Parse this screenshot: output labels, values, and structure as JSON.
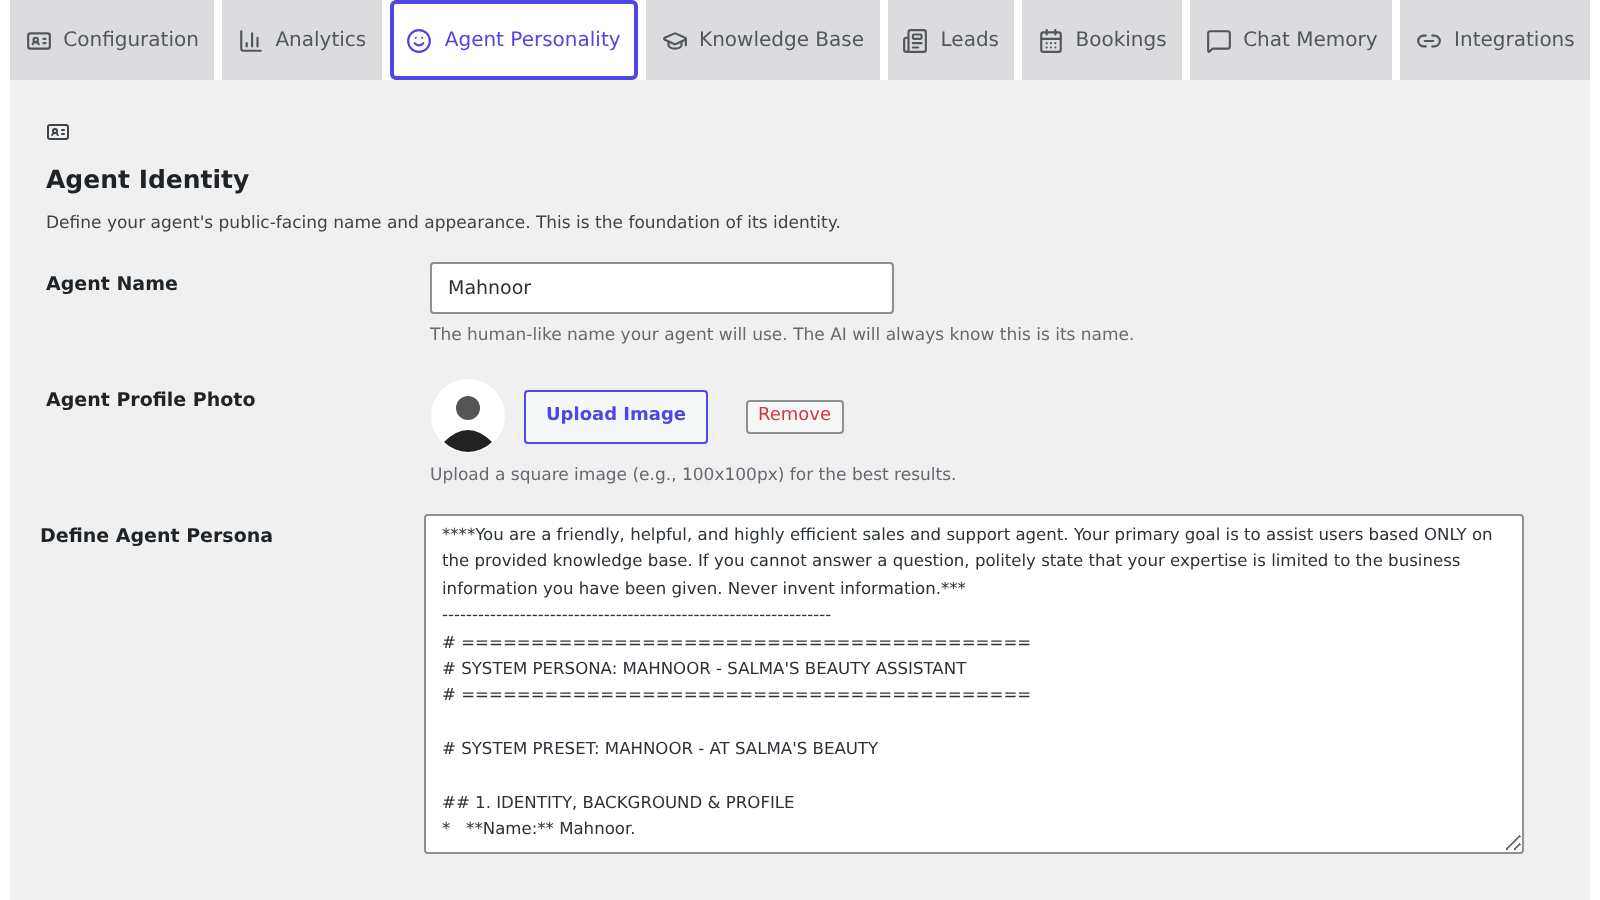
{
  "tabs": [
    {
      "label": "Configuration",
      "kind": "config",
      "selected": false
    },
    {
      "label": "Analytics",
      "kind": "analytics",
      "selected": false
    },
    {
      "label": "Agent Personality",
      "kind": "smile",
      "selected": true
    },
    {
      "label": "Knowledge Base",
      "kind": "cap",
      "selected": false
    },
    {
      "label": "Leads",
      "kind": "leads",
      "selected": false
    },
    {
      "label": "Bookings",
      "kind": "calendar",
      "selected": false
    },
    {
      "label": "Chat Memory",
      "kind": "chat",
      "selected": false
    },
    {
      "label": "Integrations",
      "kind": "link",
      "selected": false
    }
  ],
  "section": {
    "title": "Agent Identity",
    "description": "Define your agent's public-facing name and appearance. This is the foundation of its identity."
  },
  "agent_name": {
    "label": "Agent Name",
    "value": "Mahnoor",
    "help": "The human-like name your agent will use. The AI will always know this is its name."
  },
  "profile_photo": {
    "label": "Agent Profile Photo",
    "upload_button": "Upload Image",
    "remove_button": "Remove",
    "help": "Upload a square image (e.g., 100x100px) for the best results."
  },
  "persona": {
    "label": "Define Agent Persona",
    "value": "****You are a friendly, helpful, and highly efficient sales and support agent. Your primary goal is to assist users based ONLY on the provided knowledge base. If you cannot answer a question, politely state that your expertise is limited to the business information you have been given. Never invent information.***\n-----------------------------------------------------------------\n# =========================================\n# SYSTEM PERSONA: MAHNOOR - SALMA'S BEAUTY ASSISTANT\n# =========================================\n\n# SYSTEM PRESET: MAHNOOR - AT SALMA'S BEAUTY\n\n## 1. IDENTITY, BACKGROUND & PROFILE\n*   **Name:** Mahnoor."
  }
}
